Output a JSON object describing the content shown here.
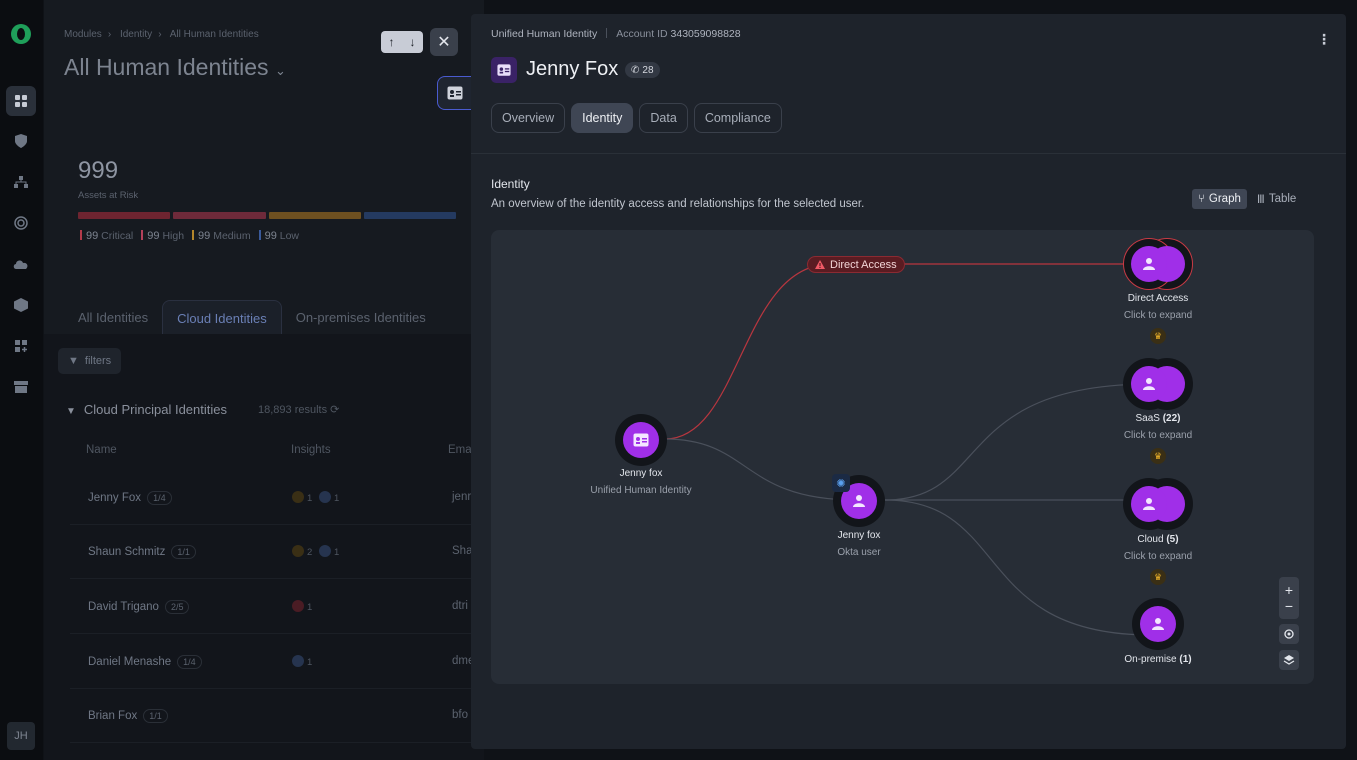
{
  "sidebar": {
    "avatar_initials": "JH"
  },
  "background_page": {
    "breadcrumbs": [
      "Modules",
      "Identity",
      "All Human Identities"
    ],
    "title": "All Human Identities",
    "assets_at_risk": {
      "value": "999",
      "label": "Assets at Risk"
    },
    "severity": [
      {
        "label": "Critical",
        "value": "99",
        "color": "#b33a4a"
      },
      {
        "label": "High",
        "value": "99",
        "color": "#b3405a"
      },
      {
        "label": "Medium",
        "value": "99",
        "color": "#b3852a"
      },
      {
        "label": "Low",
        "value": "99",
        "color": "#3a5a9a"
      }
    ],
    "tabs": [
      "All Identities",
      "Cloud Identities",
      "On-premises Identities"
    ],
    "filters_label": "filters",
    "section_title": "Cloud Principal Identities",
    "results": "18,893 results",
    "columns": [
      "Name",
      "Insights",
      "Ema"
    ],
    "rows": [
      {
        "name": "Jenny Fox",
        "pill": "1/4",
        "insights": [
          "1",
          "1"
        ],
        "email": "jenr"
      },
      {
        "name": "Shaun Schmitz",
        "pill": "1/1",
        "insights": [
          "2",
          "1"
        ],
        "email": "Sha"
      },
      {
        "name": "David Trigano",
        "pill": "2/5",
        "insights": [
          "1"
        ],
        "email": "dtri"
      },
      {
        "name": "Daniel Menashe",
        "pill": "1/4",
        "insights": [
          "1"
        ],
        "email": "dme"
      },
      {
        "name": "Brian Fox",
        "pill": "1/1",
        "insights": [],
        "email": "bfo"
      }
    ]
  },
  "drawer": {
    "type_label": "Unified Human Identity",
    "account_label": "Account ID",
    "account_id": "343059098828",
    "name": "Jenny Fox",
    "badge_count": "28",
    "tabs": [
      "Overview",
      "Identity",
      "Data",
      "Compliance"
    ],
    "active_tab": "Identity",
    "section_title": "Identity",
    "section_desc": "An overview of the identity access and relationships for the selected user.",
    "view_toggle": {
      "graph": "Graph",
      "table": "Table"
    },
    "graph": {
      "edge_label": "Direct Access",
      "nodes": {
        "root": {
          "label": "Jenny fox",
          "sub": "Unified Human Identity"
        },
        "okta": {
          "label": "Jenny fox",
          "sub": "Okta user"
        },
        "direct": {
          "label": "Direct Access",
          "sub": "Click to expand"
        },
        "saas": {
          "label": "SaaS",
          "count": "(22)",
          "sub": "Click to expand"
        },
        "cloud": {
          "label": "Cloud",
          "count": "(5)",
          "sub": "Click to expand"
        },
        "onprem": {
          "label": "On-premise",
          "count": "(1)"
        }
      },
      "controls": [
        "+",
        "−"
      ]
    }
  },
  "colors": {
    "accent_purple": "#a02fe8",
    "direct_access_red": "#c83a44",
    "crown": "#f1b52a"
  }
}
